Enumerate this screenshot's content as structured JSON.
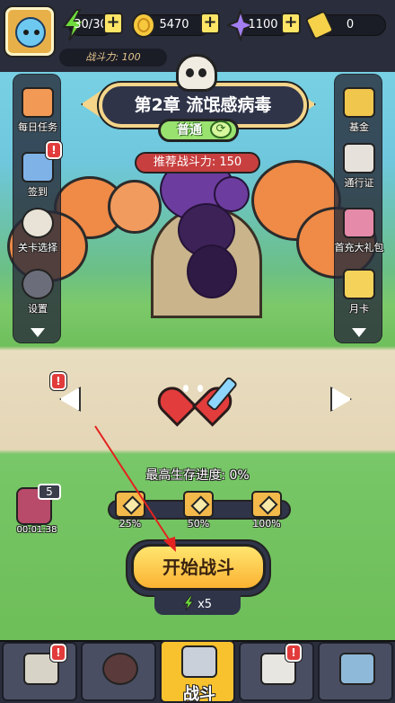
{
  "resources": {
    "energy": "30/30",
    "gold": "5470",
    "gems": "1100",
    "tickets": "0"
  },
  "power_label": "战斗力: 100",
  "chapter": {
    "title": "第2章   流氓感病毒",
    "difficulty": "普通",
    "recommended_power": "推荐战斗力: 150"
  },
  "left_menu": [
    {
      "label": "每日任务",
      "color": "#f29a55"
    },
    {
      "label": "签到",
      "color": "#7fb3e8"
    },
    {
      "label": "关卡选择",
      "color": "#e8e3d6"
    },
    {
      "label": "设置",
      "color": "#6b6e7a"
    }
  ],
  "right_menu": [
    {
      "label": "基金",
      "color": "#f1c64d"
    },
    {
      "label": "通行证",
      "color": "#e6e2db"
    },
    {
      "label": "首充大礼包",
      "color": "#e58aa8"
    },
    {
      "label": "月卡",
      "color": "#f5d25a"
    }
  ],
  "progress": {
    "title": "最高生存进度: 0%",
    "value_percent": 0,
    "milestones": [
      "25%",
      "50%",
      "100%"
    ]
  },
  "mailbox": {
    "count": "5",
    "timer": "00:01:38"
  },
  "start_button": "开始战斗",
  "energy_cost": "x5",
  "bottom_nav": [
    {
      "label": "",
      "badge": true,
      "color": "#d7d3c6"
    },
    {
      "label": "",
      "badge": false,
      "color": "#5a3a3a"
    },
    {
      "label": "战斗",
      "badge": false,
      "color": "#c9d0da"
    },
    {
      "label": "",
      "badge": true,
      "color": "#e8e6e1"
    },
    {
      "label": "",
      "badge": false,
      "color": "#8fb9d8"
    }
  ]
}
